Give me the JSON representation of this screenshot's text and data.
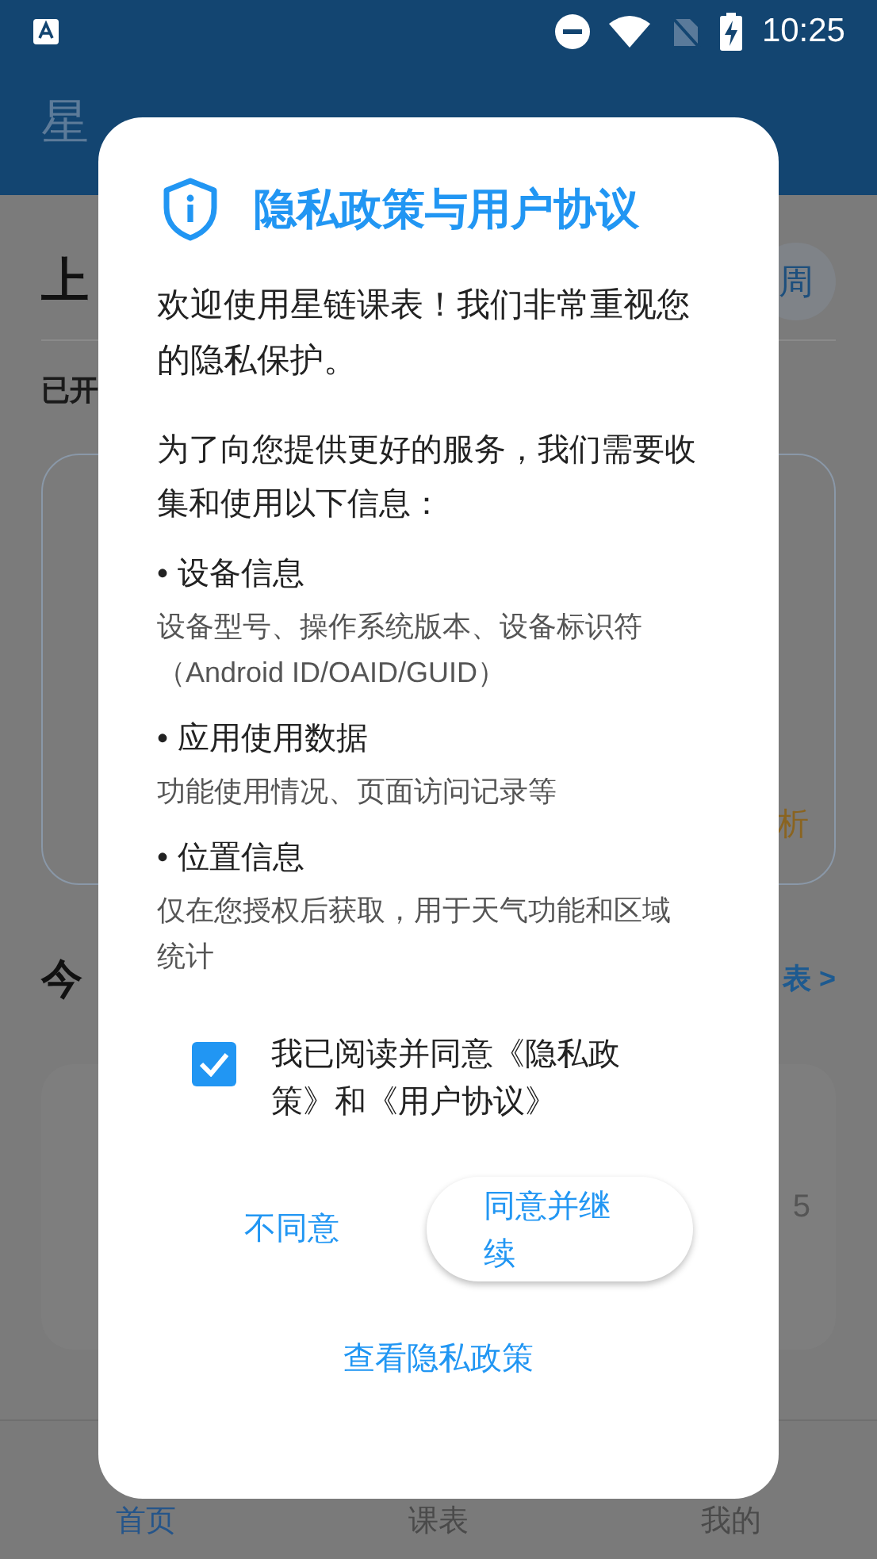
{
  "status_bar": {
    "time": "10:25"
  },
  "app_bar": {
    "title": "星"
  },
  "background": {
    "heading": "上",
    "week_chip": "周",
    "subtitle": "已开",
    "card_tag": "析",
    "today_heading": "今",
    "today_link": "表 >",
    "course_time": "5"
  },
  "dialog": {
    "title": "隐私政策与用户协议",
    "intro": "欢迎使用星链课表！我们非常重视您的隐私保护。",
    "lead": "为了向您提供更好的服务，我们需要收集和使用以下信息：",
    "items": [
      {
        "bullet": "•",
        "title": "设备信息",
        "detail": "设备型号、操作系统版本、设备标识符（Android ID/OAID/GUID）"
      },
      {
        "bullet": "•",
        "title": "应用使用数据",
        "detail": "功能使用情况、页面访问记录等"
      },
      {
        "bullet": "•",
        "title": "位置信息",
        "detail": "仅在您授权后获取，用于天气功能和区域统计"
      }
    ],
    "consent": {
      "label": "我已阅读并同意《隐私政策》和《用户协议》",
      "checked": true
    },
    "buttons": [
      {
        "label": "不同意",
        "kind": "text"
      },
      {
        "label": "同意并继续",
        "kind": "raised"
      }
    ],
    "link": "查看隐私政策"
  },
  "bottom_nav": [
    {
      "label": "首页",
      "selected": true
    },
    {
      "label": "课表",
      "selected": false
    },
    {
      "label": "我的",
      "selected": false
    }
  ]
}
